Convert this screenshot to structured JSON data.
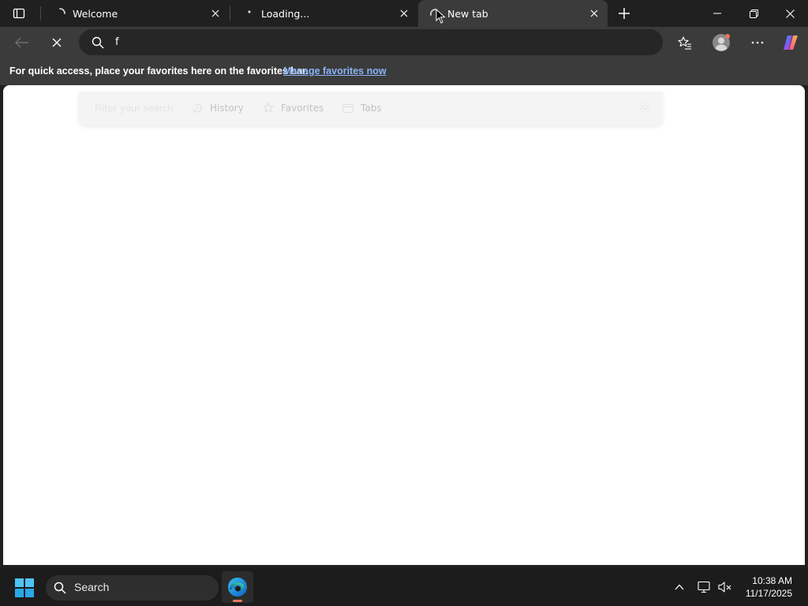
{
  "tabs": [
    {
      "title": "Welcome",
      "active": false,
      "icon": "loading-spinner-icon"
    },
    {
      "title": "Loading...",
      "active": false,
      "icon": "loading-spinner-icon"
    },
    {
      "title": "New tab",
      "active": true,
      "icon": "loading-spinner-icon"
    }
  ],
  "toolbar": {
    "address_value": "f",
    "back_icon": "back-arrow-icon",
    "stop_icon": "stop-loading-icon"
  },
  "favorites_bar": {
    "message": "For quick access, place your favorites here on the favorites bar.",
    "link": "Manage favorites now"
  },
  "dropdown": {
    "filter_label": "Filter your search",
    "items": [
      {
        "label": "History",
        "icon": "history-icon"
      },
      {
        "label": "Favorites",
        "icon": "star-icon"
      },
      {
        "label": "Tabs",
        "icon": "tabs-icon"
      }
    ]
  },
  "taskbar": {
    "search_label": "Search",
    "time": "10:38 AM",
    "date": "11/17/2025"
  },
  "colors": {
    "titlebar": "#202020",
    "toolbar": "#3b3b3b",
    "link": "#8ab4f8",
    "taskbar": "#1c1c1c"
  }
}
